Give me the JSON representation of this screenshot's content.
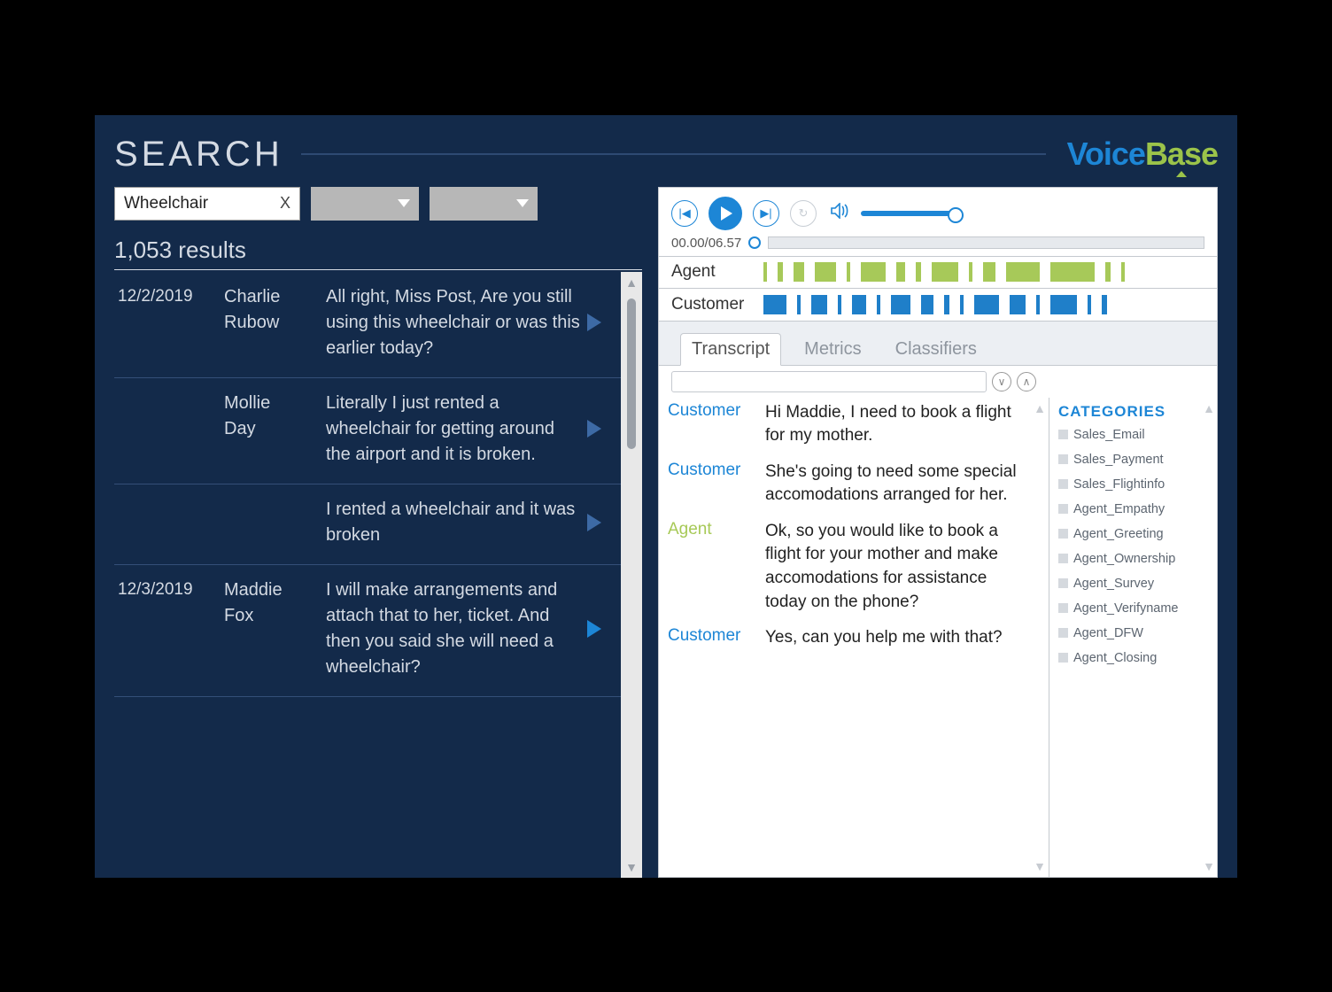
{
  "colors": {
    "accent_blue": "#1d86d6",
    "accent_green": "#9bc34a",
    "agent_green": "#a7c957"
  },
  "header": {
    "title": "SEARCH",
    "logo_a": "Voice",
    "logo_b": "Base"
  },
  "search": {
    "query": "Wheelchair",
    "clear": "X",
    "results_count": "1,053 results"
  },
  "results": [
    {
      "date": "12/2/2019",
      "name": "Charlie Rubow",
      "text": "All right, Miss Post, Are you still using this wheelchair or was this earlier today?",
      "active": false
    },
    {
      "date": "",
      "name": "Mollie Day",
      "text": "Literally I just rented a wheelchair for getting around the airport and it is broken.",
      "active": false
    },
    {
      "date": "",
      "name": "",
      "text": "I rented a wheelchair and it was broken",
      "active": false
    },
    {
      "date": "12/3/2019",
      "name": "Maddie Fox",
      "text": "I will make arrangements and attach that to her, ticket. And then you said she will need a wheelchair?",
      "active": true
    }
  ],
  "player": {
    "time": "00.00/06.57",
    "tracks": [
      {
        "label": "Agent"
      },
      {
        "label": "Customer"
      }
    ]
  },
  "tabs": [
    {
      "label": "Transcript",
      "active": true
    },
    {
      "label": "Metrics",
      "active": false
    },
    {
      "label": "Classifiers",
      "active": false
    }
  ],
  "transcript": [
    {
      "speaker": "Customer",
      "cls": "cust",
      "text": "Hi Maddie, I need to book a flight for my mother."
    },
    {
      "speaker": "Customer",
      "cls": "cust",
      "text": "She's going to need some special accomodations arranged for her."
    },
    {
      "speaker": "Agent",
      "cls": "agent",
      "text": "Ok, so you would like to book a flight for your mother and make accomodations for assistance today on the phone?"
    },
    {
      "speaker": "Customer",
      "cls": "cust",
      "text": "Yes, can you help me with that?"
    }
  ],
  "categories_title": "CATEGORIES",
  "categories": [
    "Sales_Email",
    "Sales_Payment",
    "Sales_Flightinfo",
    "Agent_Empathy",
    "Agent_Greeting",
    "Agent_Ownership",
    "Agent_Survey",
    "Agent_Verifyname",
    "Agent_DFW",
    "Agent_Closing"
  ],
  "waveform": {
    "agent": [
      4,
      6,
      12,
      24,
      4,
      28,
      10,
      6,
      30,
      4,
      14,
      38,
      50,
      6,
      4
    ],
    "customer": [
      26,
      4,
      18,
      4,
      16,
      4,
      22,
      14,
      6,
      4,
      28,
      18,
      4,
      30,
      4,
      6
    ]
  }
}
